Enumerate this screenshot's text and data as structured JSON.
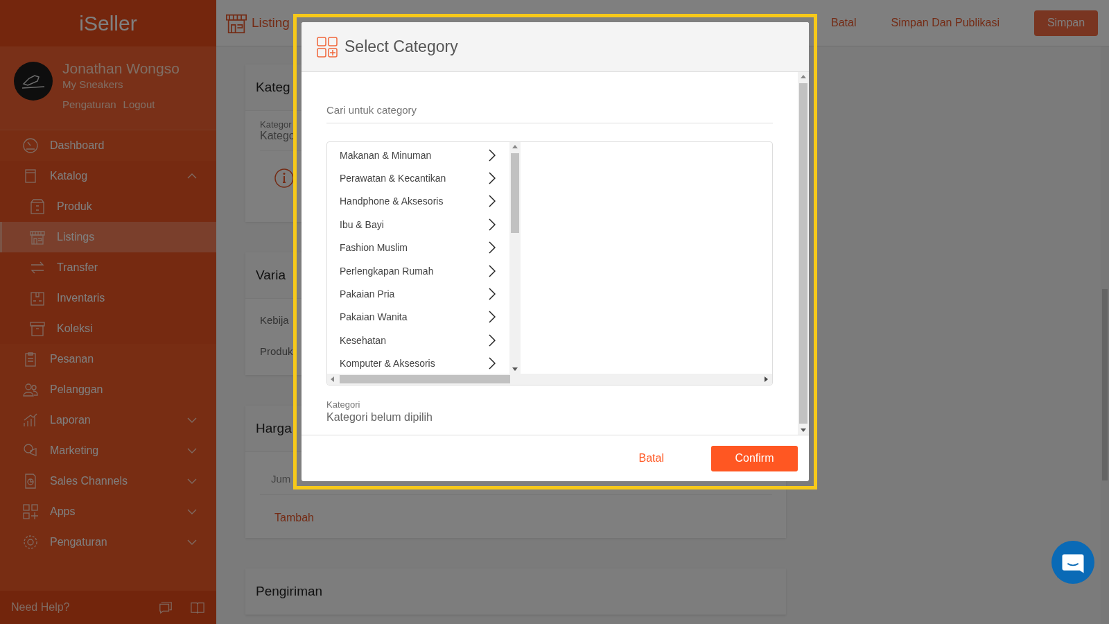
{
  "sidebar": {
    "brand": "iSeller",
    "user": {
      "name": "Jonathan Wongso",
      "store": "My Sneakers",
      "links": [
        "Pengaturan",
        "Logout"
      ]
    },
    "items": [
      {
        "label": "Dashboard",
        "selected": false
      },
      {
        "label": "Katalog",
        "selected": false,
        "expanded": true,
        "children": [
          {
            "label": "Produk",
            "selected": false
          },
          {
            "label": "Listings",
            "selected": true
          },
          {
            "label": "Transfer",
            "selected": false
          },
          {
            "label": "Inventaris",
            "selected": false
          },
          {
            "label": "Koleksi",
            "selected": false
          }
        ]
      },
      {
        "label": "Pesanan",
        "selected": false
      },
      {
        "label": "Pelanggan",
        "selected": false
      },
      {
        "label": "Laporan",
        "selected": false,
        "expanded": false
      },
      {
        "label": "Marketing",
        "selected": false,
        "expanded": false
      },
      {
        "label": "Sales Channels",
        "selected": false,
        "expanded": false
      },
      {
        "label": "Apps",
        "selected": false,
        "expanded": false
      },
      {
        "label": "Pengaturan",
        "selected": false,
        "expanded": false
      }
    ],
    "help": "Need Help?"
  },
  "topbar": {
    "breadcrumb": "Listing",
    "actions": [
      {
        "label": "Batal",
        "kind": "link"
      },
      {
        "label": "Simpan Dan Publikasi",
        "kind": "link"
      },
      {
        "label": "Simpan",
        "kind": "button"
      }
    ]
  },
  "cards": [
    {
      "title": "Kateg",
      "rows": [
        {
          "kind": "field",
          "label": "Kategor",
          "value": "Katego"
        },
        {
          "kind": "info"
        }
      ]
    },
    {
      "title": "Varia",
      "rows": [
        {
          "kind": "text",
          "text": "Kebija"
        },
        {
          "kind": "text",
          "text": "Produk"
        }
      ]
    },
    {
      "title": "Harga",
      "rows": [
        {
          "kind": "subtext",
          "text": "Jum"
        },
        {
          "kind": "link",
          "text": "Tambah"
        }
      ]
    },
    {
      "title": "Pengiriman"
    }
  ],
  "modal": {
    "title": "Select Category",
    "search": {
      "placeholder": "Cari untuk category"
    },
    "categories": [
      {
        "label": "Makanan & Minuman"
      },
      {
        "label": "Perawatan & Kecantikan"
      },
      {
        "label": "Handphone & Aksesoris"
      },
      {
        "label": "Ibu & Bayi"
      },
      {
        "label": "Fashion Muslim"
      },
      {
        "label": "Perlengkapan Rumah"
      },
      {
        "label": "Pakaian Pria"
      },
      {
        "label": "Pakaian Wanita"
      },
      {
        "label": "Kesehatan"
      },
      {
        "label": "Komputer & Aksesoris"
      }
    ],
    "selection": {
      "label": "Kategori",
      "value": "Kategori belum dipilih"
    },
    "buttons": [
      {
        "label": "Batal",
        "kind": "text"
      },
      {
        "label": "Confirm",
        "kind": "primary"
      }
    ]
  }
}
